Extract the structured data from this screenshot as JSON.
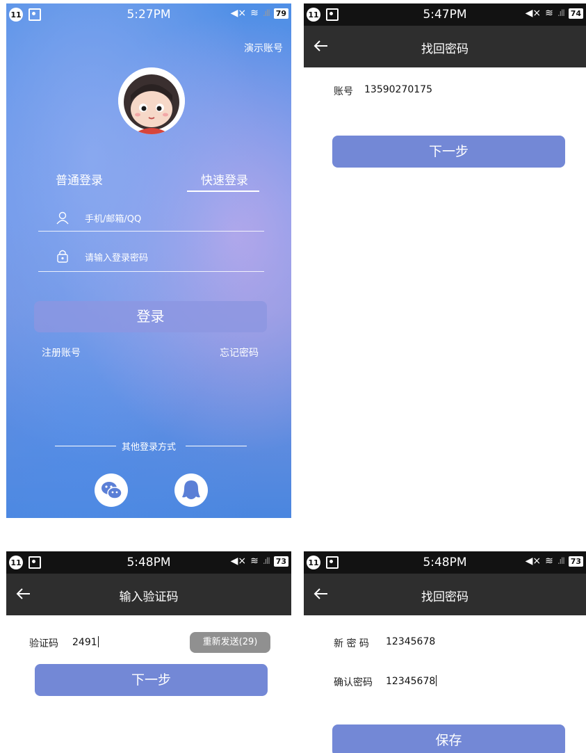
{
  "status_bars": {
    "login": {
      "badge": "11",
      "time": "5:27PM",
      "battery": "79"
    },
    "find_password": {
      "badge": "11",
      "time": "5:47PM",
      "battery": "74"
    },
    "verify_code": {
      "badge": "11",
      "time": "5:48PM",
      "battery": "73"
    },
    "new_password": {
      "badge": "11",
      "time": "5:48PM",
      "battery": "73"
    }
  },
  "login": {
    "demo_account": "演示账号",
    "tab_normal": "普通登录",
    "tab_quick": "快速登录",
    "account_placeholder": "手机/邮箱/QQ",
    "password_placeholder": "请输入登录密码",
    "login_button": "登录",
    "register_link": "注册账号",
    "forgot_link": "忘记密码",
    "other_methods": "其他登录方式"
  },
  "find_password": {
    "title": "找回密码",
    "account_label": "账号",
    "account_value": "13590270175",
    "next_button": "下一步"
  },
  "verify_code": {
    "title": "输入验证码",
    "code_label": "验证码",
    "code_value": "2491",
    "resend_button": "重新发送(29)",
    "next_button": "下一步"
  },
  "new_password": {
    "title": "找回密码",
    "new_label": "新 密 码",
    "new_value": "12345678",
    "confirm_label": "确认密码",
    "confirm_value": "12345678",
    "save_button": "保存"
  },
  "colors": {
    "top_bar": "#2e2e2e",
    "status_bar": "#121212",
    "primary_button": "#7388d6",
    "resend_button": "#909090"
  }
}
